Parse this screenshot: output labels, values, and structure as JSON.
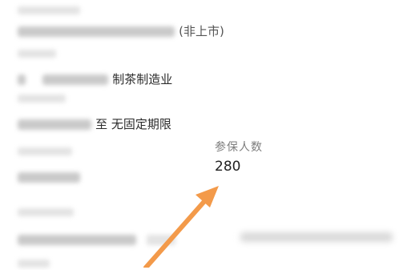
{
  "fields": [
    {
      "value_text": "(非上市)"
    },
    {
      "value_text": "制茶制造业"
    },
    {
      "value_text": "至 无固定期限"
    }
  ],
  "highlight": {
    "label": "参保人数",
    "value": "280"
  },
  "annotation": {
    "arrow_color": "#f39a4a"
  }
}
